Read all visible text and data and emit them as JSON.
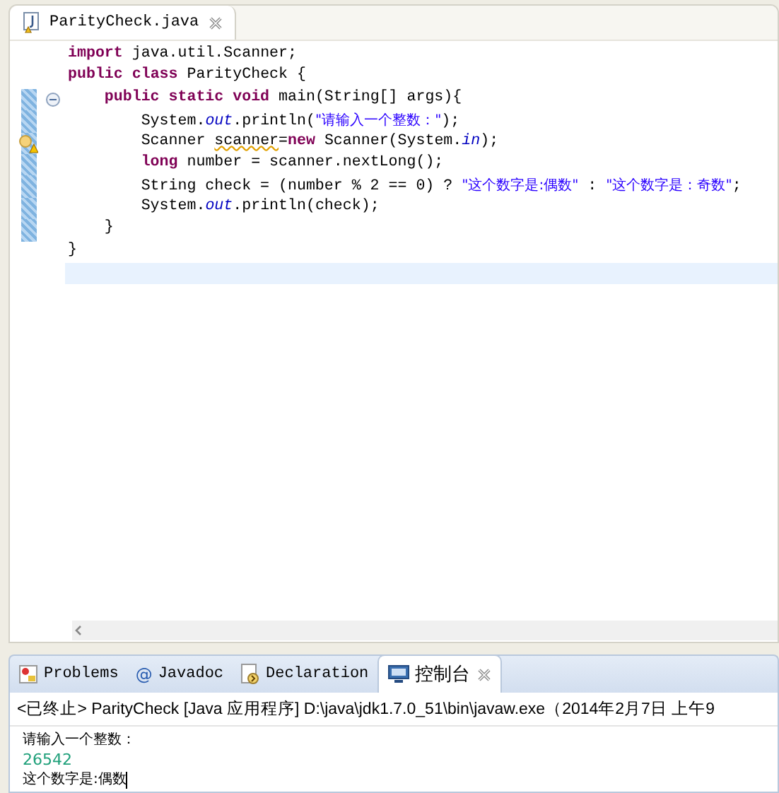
{
  "editor": {
    "tab": {
      "label": "ParityCheck.java",
      "selected": true
    },
    "lines": [
      {
        "changed": false,
        "tokens": [
          {
            "kind": "keyword",
            "text": "import"
          },
          {
            "kind": "plain",
            "text": " java.util.Scanner;"
          }
        ]
      },
      {
        "changed": false,
        "tokens": [
          {
            "kind": "keyword",
            "text": "public class"
          },
          {
            "kind": "plain",
            "text": " ParityCheck {"
          }
        ],
        "children": [
          {
            "changed": true,
            "expanded": true,
            "tokens": [
              {
                "kind": "keyword",
                "text": "public static void"
              },
              {
                "kind": "plain",
                "text": " main(String[] args){"
              }
            ],
            "children": [
              {
                "changed": true,
                "tokens": [
                  {
                    "kind": "plain",
                    "text": "System."
                  },
                  {
                    "kind": "field",
                    "text": "out"
                  },
                  {
                    "kind": "plain",
                    "text": ".println("
                  },
                  {
                    "kind": "string",
                    "text": "\"请输入一个整数：\""
                  },
                  {
                    "kind": "plain",
                    "text": ");"
                  }
                ]
              },
              {
                "changed": true,
                "warning": true,
                "tokens": [
                  {
                    "kind": "plain",
                    "text": "Scanner "
                  },
                  {
                    "kind": "warning",
                    "text": "scanner"
                  },
                  {
                    "kind": "plain",
                    "text": "="
                  },
                  {
                    "kind": "keyword",
                    "text": "new"
                  },
                  {
                    "kind": "plain",
                    "text": " Scanner(System."
                  },
                  {
                    "kind": "field",
                    "text": "in"
                  },
                  {
                    "kind": "plain",
                    "text": ");"
                  }
                ]
              },
              {
                "changed": true,
                "tokens": [
                  {
                    "kind": "keyword",
                    "text": "long"
                  },
                  {
                    "kind": "plain",
                    "text": " number = scanner.nextLong();"
                  }
                ]
              },
              {
                "changed": true,
                "tokens": [
                  {
                    "kind": "plain",
                    "text": "String check = (number % 2 == 0) ? "
                  },
                  {
                    "kind": "string",
                    "text": "\"这个数字是:偶数\""
                  },
                  {
                    "kind": "plain",
                    "text": " : "
                  },
                  {
                    "kind": "string",
                    "text": "\"这个数字是：奇数\""
                  },
                  {
                    "kind": "plain",
                    "text": ";"
                  }
                ]
              },
              {
                "changed": true,
                "tokens": [
                  {
                    "kind": "plain",
                    "text": "System."
                  },
                  {
                    "kind": "field",
                    "text": "out"
                  },
                  {
                    "kind": "plain",
                    "text": ".println(check);"
                  }
                ]
              }
            ]
          },
          {
            "changed": true,
            "tokens": [
              {
                "kind": "plain",
                "text": "}"
              }
            ]
          }
        ]
      },
      {
        "changed": false,
        "tokens": [
          {
            "kind": "plain",
            "text": "}"
          }
        ]
      },
      {
        "changed": false,
        "current": true
      }
    ]
  },
  "console": {
    "tabs": [
      {
        "label": "Problems",
        "selected": false
      },
      {
        "label": "Javadoc",
        "icon_text": "@",
        "selected": false
      },
      {
        "label": "Declaration",
        "selected": false
      },
      {
        "label": "控制台",
        "selected": true
      }
    ],
    "header": "<已终止> ParityCheck [Java 应用程序] D:\\java\\jdk1.7.0_51\\bin\\javaw.exe（2014年2月7日 上午9",
    "lines": [
      {
        "kind": "output",
        "text": "请输入一个整数："
      },
      {
        "kind": "input",
        "text": "26542"
      },
      {
        "kind": "output",
        "text": "这个数字是:偶数"
      }
    ]
  }
}
